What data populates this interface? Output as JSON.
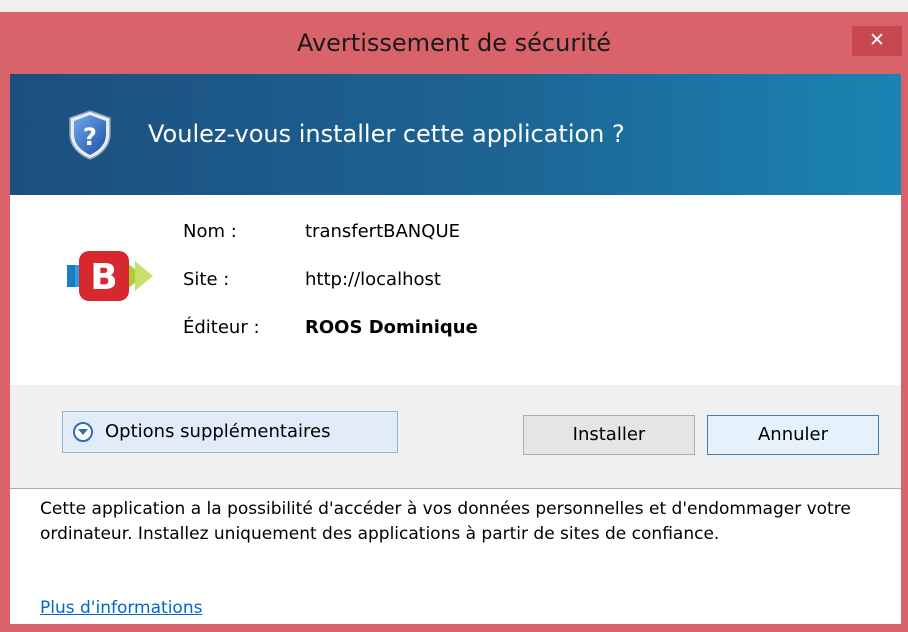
{
  "window": {
    "title": "Avertissement de sécurité",
    "close_glyph": "✕"
  },
  "header": {
    "icon": "shield-question-icon",
    "question": "Voulez-vous installer cette application ?"
  },
  "app": {
    "icon": "transfertbanque-app-icon",
    "fields": [
      {
        "label": "Nom :",
        "value": "transfertBANQUE"
      },
      {
        "label": "Site :",
        "value": "http://localhost"
      },
      {
        "label": "Éditeur :",
        "value": "ROOS Dominique"
      }
    ]
  },
  "actions": {
    "options_label": "Options supplémentaires",
    "install_label": "Installer",
    "cancel_label": "Annuler"
  },
  "warning": {
    "text": "Cette application a la possibilité d'accéder à vos données personnelles et d'endommager votre ordinateur. Installez uniquement des applications à partir de sites de confiance.",
    "link": "Plus d'informations"
  },
  "colors": {
    "frame": "#d9636b",
    "header_start": "#1b4f7e",
    "header_end": "#1a84b3",
    "link": "#0066cc"
  }
}
